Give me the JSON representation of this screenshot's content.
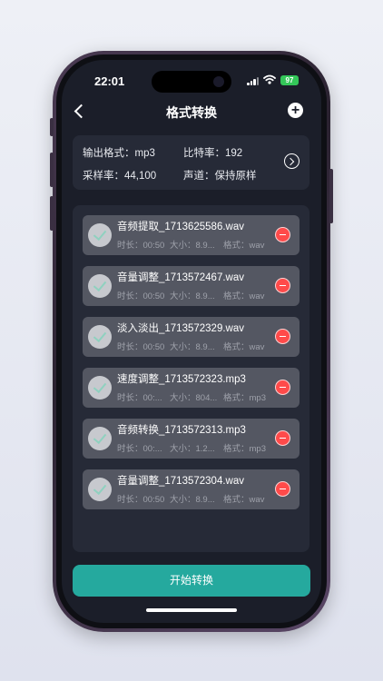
{
  "status": {
    "time": "22:01",
    "battery": "97"
  },
  "nav": {
    "title": "格式转换"
  },
  "settings": {
    "output_format": "输出格式：mp3",
    "bitrate": "比特率：192",
    "sample_rate": "采样率：44,100",
    "channel": "声道：保持原样"
  },
  "files": [
    {
      "name": "音频提取_1713625586.wav",
      "duration": "时长：00:50",
      "size": "大小：8.9...",
      "format": "格式：wav"
    },
    {
      "name": "音量调整_1713572467.wav",
      "duration": "时长：00:50",
      "size": "大小：8.9...",
      "format": "格式：wav"
    },
    {
      "name": "淡入淡出_1713572329.wav",
      "duration": "时长：00:50",
      "size": "大小：8.9...",
      "format": "格式：wav"
    },
    {
      "name": "速度调整_1713572323.mp3",
      "duration": "时长：00:...",
      "size": "大小：804...",
      "format": "格式：mp3"
    },
    {
      "name": "音频转换_1713572313.mp3",
      "duration": "时长：00:...",
      "size": "大小：1.2...",
      "format": "格式：mp3"
    },
    {
      "name": "音量调整_1713572304.wav",
      "duration": "时长：00:50",
      "size": "大小：8.9...",
      "format": "格式：wav"
    }
  ],
  "actions": {
    "start": "开始转换"
  },
  "colors": {
    "accent": "#25a99e",
    "delete": "#ff4a4a",
    "background": "#1b1e29"
  }
}
